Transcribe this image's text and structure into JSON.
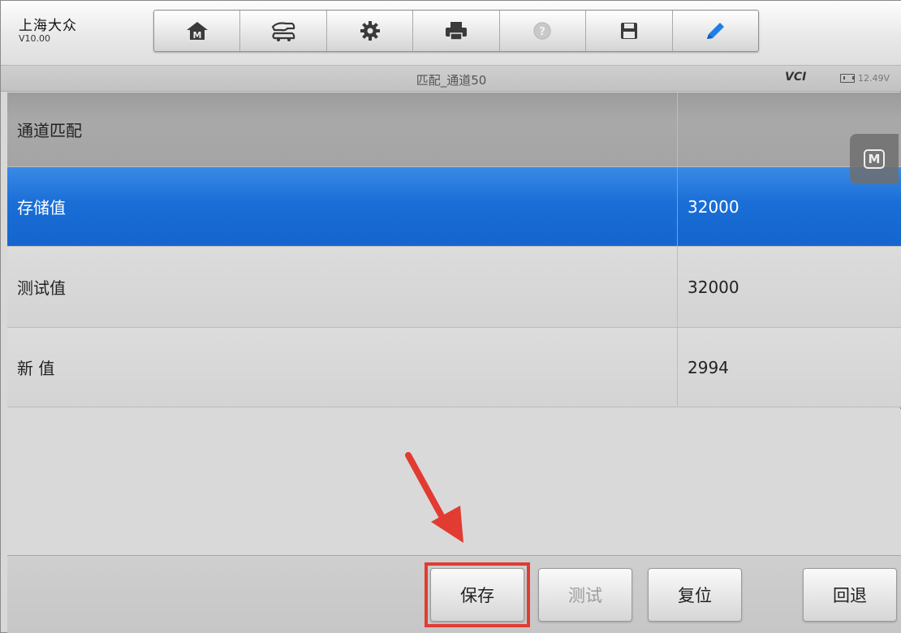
{
  "app": {
    "name": "上海大众",
    "version": "V10.00"
  },
  "toolbar": {
    "items": [
      {
        "icon": "home-icon"
      },
      {
        "icon": "vehicle-swap-icon"
      },
      {
        "icon": "gear-icon"
      },
      {
        "icon": "print-icon"
      },
      {
        "icon": "help-icon",
        "disabled": true
      },
      {
        "icon": "save-icon"
      },
      {
        "icon": "pen-icon"
      }
    ]
  },
  "titlebar": {
    "title": "匹配_通道50",
    "vci_label": "VCI",
    "vci_prefix": "VCI",
    "vci_accent": "",
    "voltage": "12.49V"
  },
  "table": {
    "header": {
      "label": "通道匹配",
      "value": ""
    },
    "rows": [
      {
        "label": "存储值",
        "value": "32000",
        "selected": true
      },
      {
        "label": "测试值",
        "value": "32000"
      },
      {
        "label": "新 值",
        "value": "2994"
      }
    ]
  },
  "floating": {
    "m_label": "M"
  },
  "actions": {
    "save": "保存",
    "test": "测试",
    "reset": "复位",
    "back": "回退"
  },
  "colors": {
    "selected_row": "#1a6ed6",
    "highlight": "#e23b32",
    "vci_accent": "#3cab2c"
  }
}
